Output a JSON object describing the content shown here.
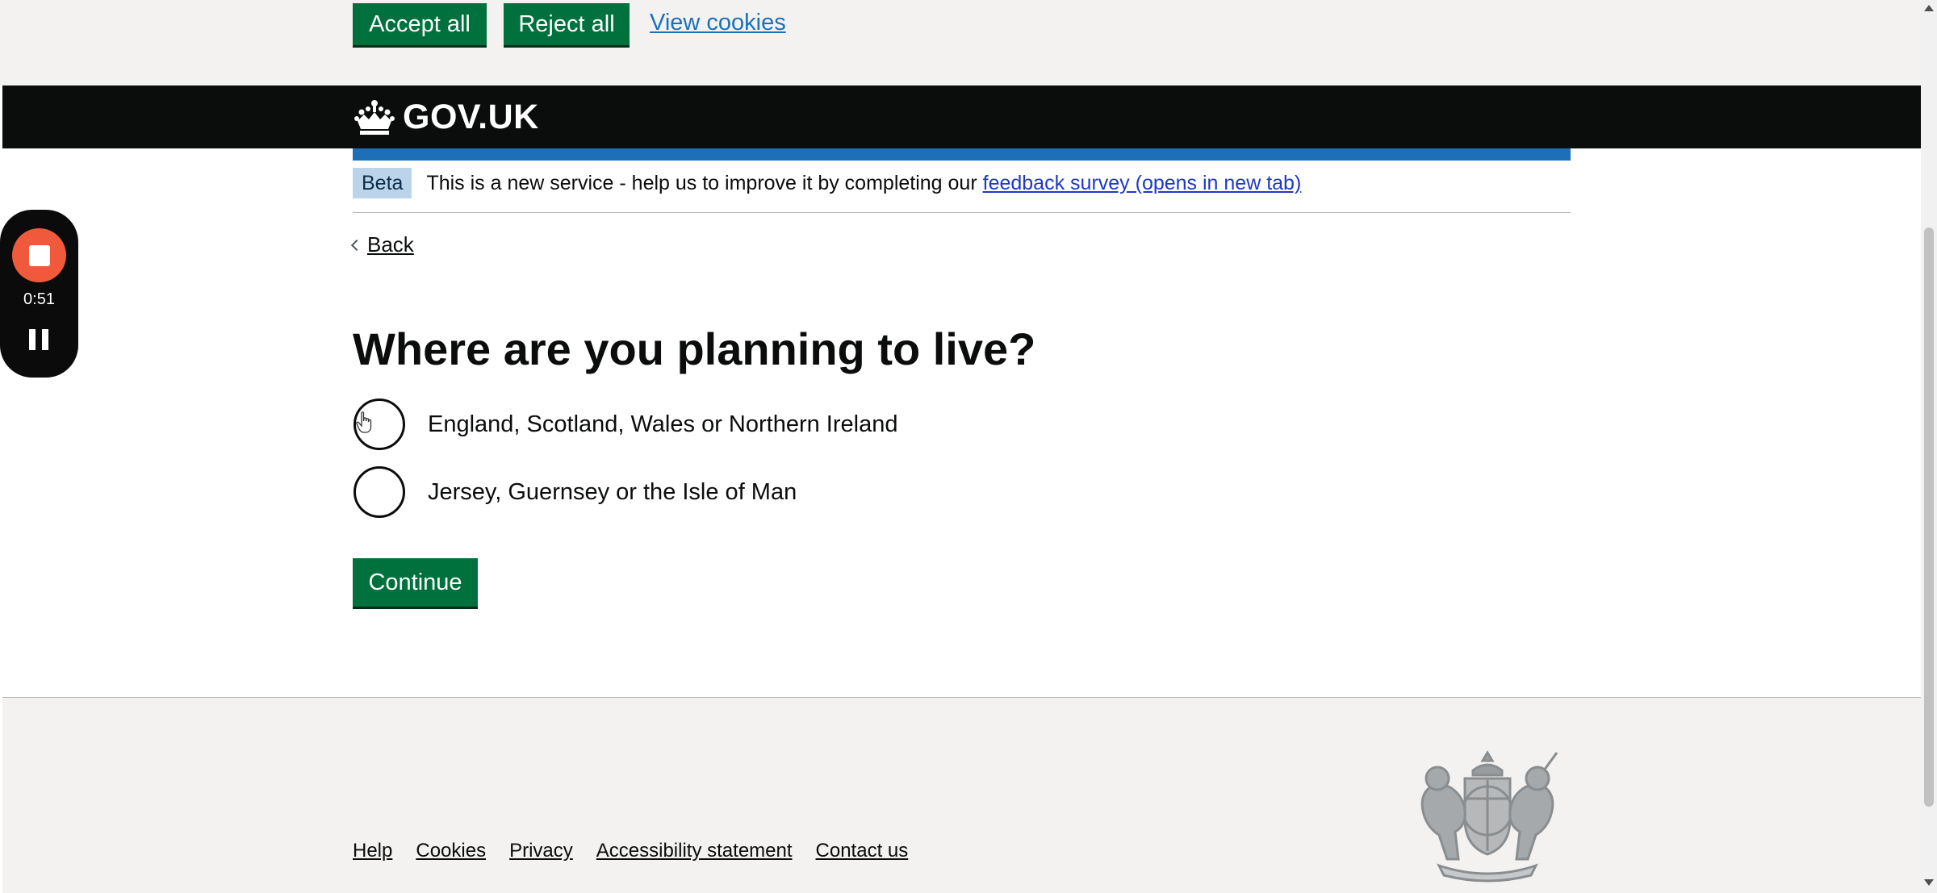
{
  "cookie_banner": {
    "accept_label": "Accept all",
    "reject_label": "Reject all",
    "view_label": "View cookies"
  },
  "header": {
    "logo_text": "GOV.UK",
    "logo_icon": "crown-icon"
  },
  "phase_banner": {
    "tag": "Beta",
    "text": "This is a new service - help us to improve it by completing our",
    "link_text": "feedback survey (opens in new tab)"
  },
  "back_link": {
    "label": "Back"
  },
  "question": {
    "title": "Where are you planning to live?",
    "options": [
      {
        "label": "England, Scotland, Wales or Northern Ireland",
        "selected": false
      },
      {
        "label": "Jersey, Guernsey or the Isle of Man",
        "selected": false
      }
    ],
    "continue_label": "Continue"
  },
  "footer": {
    "links": [
      "Help",
      "Cookies",
      "Privacy",
      "Accessibility statement",
      "Contact us"
    ],
    "crest_icon": "royal-coat-of-arms-icon"
  },
  "recorder": {
    "time": "0:51"
  },
  "colors": {
    "button_green": "#00703c",
    "link_blue": "#1d70b8",
    "header_black": "#0b0c0c",
    "recorder_red": "#f0593c",
    "beta_tag_bg": "#bbd4ea"
  }
}
